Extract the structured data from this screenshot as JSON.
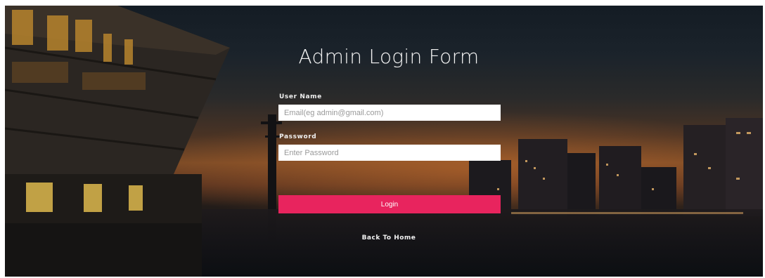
{
  "page": {
    "title": "Admin Login Form"
  },
  "form": {
    "username_label": "User Name",
    "username_placeholder": "Email(eg admin@gmail.com)",
    "username_value": "",
    "password_label": "Password",
    "password_placeholder": "Enter Password",
    "password_value": "",
    "login_label": "Login",
    "back_label": "Back To Home"
  },
  "colors": {
    "login_button": "#e8245e",
    "text": "#f3f3f3",
    "field_background": "#ffffff"
  }
}
